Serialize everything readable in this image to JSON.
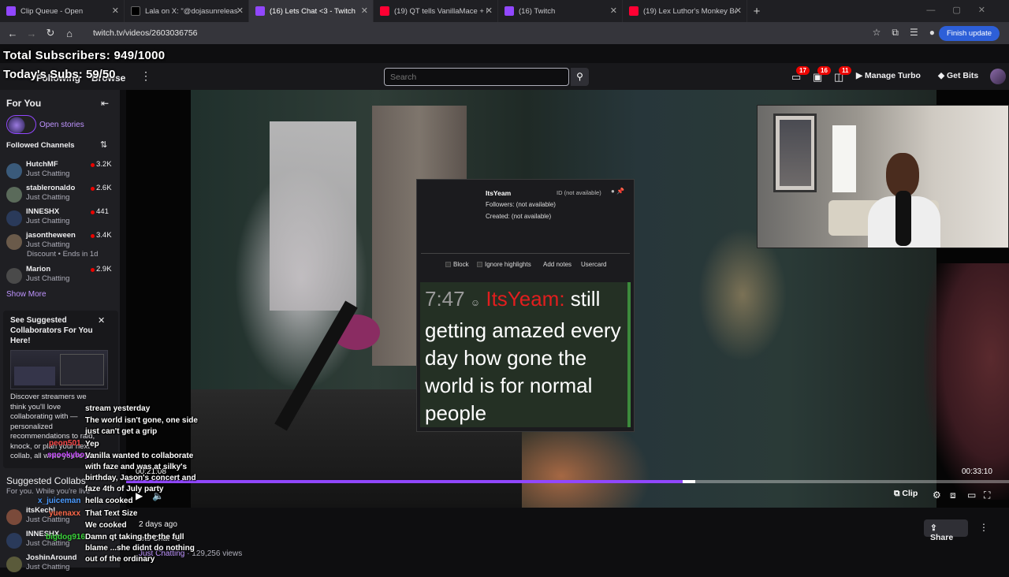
{
  "browser": {
    "tabs": [
      {
        "title": "Clip Queue - Open",
        "color": "#9147ff"
      },
      {
        "title": "Lala on X: \"@dojasunreleased u",
        "color": "#000000"
      },
      {
        "title": "(16) Lets Chat <3 - Twitch",
        "color": "#9147ff"
      },
      {
        "title": "(19) QT tells VanillaMace + Kat",
        "color": "#ff0033"
      },
      {
        "title": "(16) Twitch",
        "color": "#9147ff"
      },
      {
        "title": "(19) Lex Luthor's Monkey Bots",
        "color": "#ff0033"
      }
    ],
    "active_tab": 2,
    "url": "twitch.tv/videos/2603036756",
    "finish_update": "Finish update"
  },
  "overlay": {
    "total_subs": "Total Subscribers: 949/1000",
    "today_subs": "Today's Subs: 59/50"
  },
  "topnav": {
    "following": "Following",
    "browse": "Browse",
    "search_placeholder": "Search",
    "badges": [
      "17",
      "16",
      "11"
    ],
    "manage_turbo": "Manage Turbo",
    "get_bits": "Get Bits"
  },
  "sidebar": {
    "for_you": "For You",
    "open_stories": "Open stories",
    "followed_channels": "Followed Channels",
    "channels": [
      {
        "name": "HutchMF",
        "game": "Just Chatting",
        "viewers": "3.2K",
        "color": "#3a5a7a"
      },
      {
        "name": "stableronaldo",
        "game": "Just Chatting",
        "viewers": "2.6K",
        "color": "#5a6a5a"
      },
      {
        "name": "INNESHX",
        "game": "Just Chatting",
        "viewers": "441",
        "color": "#2a3a5a"
      },
      {
        "name": "jasontheween",
        "game": "Just Chatting",
        "viewers": "3.4K",
        "color": "#6a5a4a"
      },
      {
        "name": "Marion",
        "game": "Just Chatting",
        "viewers": "2.9K",
        "color": "#4a4a4a"
      }
    ],
    "discount": "Discount • Ends in 1d",
    "show_more": "Show More",
    "promo": {
      "title": "See Suggested Collaborators For You Here!",
      "body": "Discover streamers we think you'll love collaborating with — personalized recommendations to raid, knock, or plan your next collab, all while you're live."
    },
    "suggested_title": "Suggested Collabs",
    "suggested_sub": "For you. While you're live",
    "suggested": [
      {
        "name": "itsKechl",
        "game": "Just Chatting",
        "color": "#7a4a3a"
      },
      {
        "name": "INNESHX",
        "game": "Just Chatting",
        "color": "#2a3a5a"
      },
      {
        "name": "JoshinAround",
        "game": "Just Chatting",
        "color": "#5a5a3a"
      }
    ]
  },
  "usercard": {
    "username": "ItsYeam",
    "id": "ID (not available)",
    "followers": "Followers: (not available)",
    "created": "Created: (not available)",
    "actions": [
      "Block",
      "Ignore highlights",
      "Add notes",
      "Usercard"
    ],
    "time": "7:47",
    "msg_user": "ItsYeam:",
    "msg_text": "still getting amazed every day how gone the world is for normal people"
  },
  "player": {
    "elapsed": "00:21:08",
    "duration": "00:33:10",
    "progress": 0.632,
    "clip": "Clip"
  },
  "video_info": {
    "ago": "2 days ago",
    "title": "Lets Chat <3",
    "category": "Just Chatting",
    "views": "129,256 views",
    "share": "Share"
  },
  "chat_overlay": {
    "lines": [
      "stream yesterday",
      "The world isn't gone, one side",
      "just can't get a grip",
      "Yep",
      "Vanilla wanted to collaborate",
      "with faze and was at silky's",
      "birthday, Jason's concert and",
      "faze 4th of July party",
      "hella cooked",
      "That Text Size",
      "We cooked",
      "Damn qt taking the the full",
      "blame ...she didnt do nothing",
      "out of the ordinary"
    ],
    "users": [
      {
        "name": "peon501",
        "color": "#ff4b4b"
      },
      {
        "name": "x_juiceman",
        "color": "#4b9bff"
      },
      {
        "name": "spookyboy",
        "color": "#c84bff"
      },
      {
        "name": "yuenaxx",
        "color": "#ff6a4b"
      },
      {
        "name": "bigdog916",
        "color": "#3ad43a"
      }
    ]
  }
}
